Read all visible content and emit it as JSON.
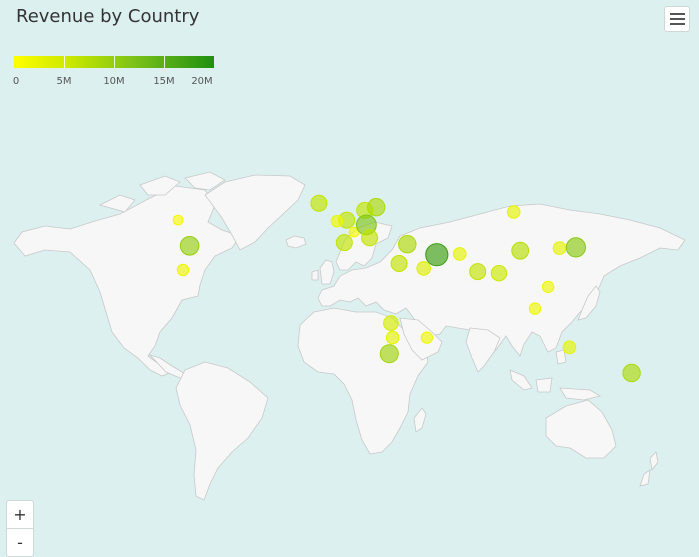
{
  "title": "Revenue by Country",
  "menu_icon": "hamburger-icon",
  "legend": {
    "min": 0,
    "max": 20,
    "ticks": [
      "0",
      "5M",
      "10M",
      "15M",
      "20M"
    ],
    "colors": [
      "#ffff00",
      "#c6e600",
      "#7cc218",
      "#1e8f10"
    ]
  },
  "zoom": {
    "in_label": "+",
    "out_label": "-"
  },
  "colors": {
    "background": "#dcf0f0",
    "land": "#f7f7f7",
    "border": "#c8c8c8"
  },
  "chart_data": {
    "type": "bubble-map",
    "title": "Revenue by Country",
    "unit": "M",
    "points": [
      {
        "lon": -105,
        "lat": 54,
        "value": 1
      },
      {
        "lon": -98,
        "lat": 38,
        "value": 11
      },
      {
        "lon": -102,
        "lat": 23,
        "value": 2
      },
      {
        "lon": -19,
        "lat": 64.5,
        "value": 7
      },
      {
        "lon": -2,
        "lat": 54,
        "value": 7
      },
      {
        "lon": -8,
        "lat": 53.3,
        "value": 2
      },
      {
        "lon": 2.5,
        "lat": 46.5,
        "value": 1
      },
      {
        "lon": -3.5,
        "lat": 40,
        "value": 7
      },
      {
        "lon": 9,
        "lat": 60,
        "value": 7
      },
      {
        "lon": 16,
        "lat": 62,
        "value": 9
      },
      {
        "lon": 10,
        "lat": 51,
        "value": 13
      },
      {
        "lon": 12,
        "lat": 43,
        "value": 7
      },
      {
        "lon": 35,
        "lat": 39,
        "value": 9
      },
      {
        "lon": 30,
        "lat": 27,
        "value": 7
      },
      {
        "lon": 45,
        "lat": 24,
        "value": 4
      },
      {
        "lon": 53,
        "lat": 32.5,
        "value": 18
      },
      {
        "lon": 67,
        "lat": 33,
        "value": 3
      },
      {
        "lon": 100,
        "lat": 59,
        "value": 3
      },
      {
        "lon": 104,
        "lat": 35,
        "value": 8
      },
      {
        "lon": 78,
        "lat": 22,
        "value": 7
      },
      {
        "lon": 91,
        "lat": 21,
        "value": 6
      },
      {
        "lon": 128,
        "lat": 36.5,
        "value": 3
      },
      {
        "lon": 138,
        "lat": 37,
        "value": 12
      },
      {
        "lon": 121,
        "lat": 12.5,
        "value": 2
      },
      {
        "lon": 113,
        "lat": -1,
        "value": 2
      },
      {
        "lon": 134,
        "lat": -25,
        "value": 3
      },
      {
        "lon": 172,
        "lat": -41,
        "value": 9
      },
      {
        "lon": 25,
        "lat": -10,
        "value": 5
      },
      {
        "lon": 26,
        "lat": -19,
        "value": 3
      },
      {
        "lon": 24,
        "lat": -29,
        "value": 10
      },
      {
        "lon": 47,
        "lat": -19,
        "value": 2
      }
    ]
  }
}
